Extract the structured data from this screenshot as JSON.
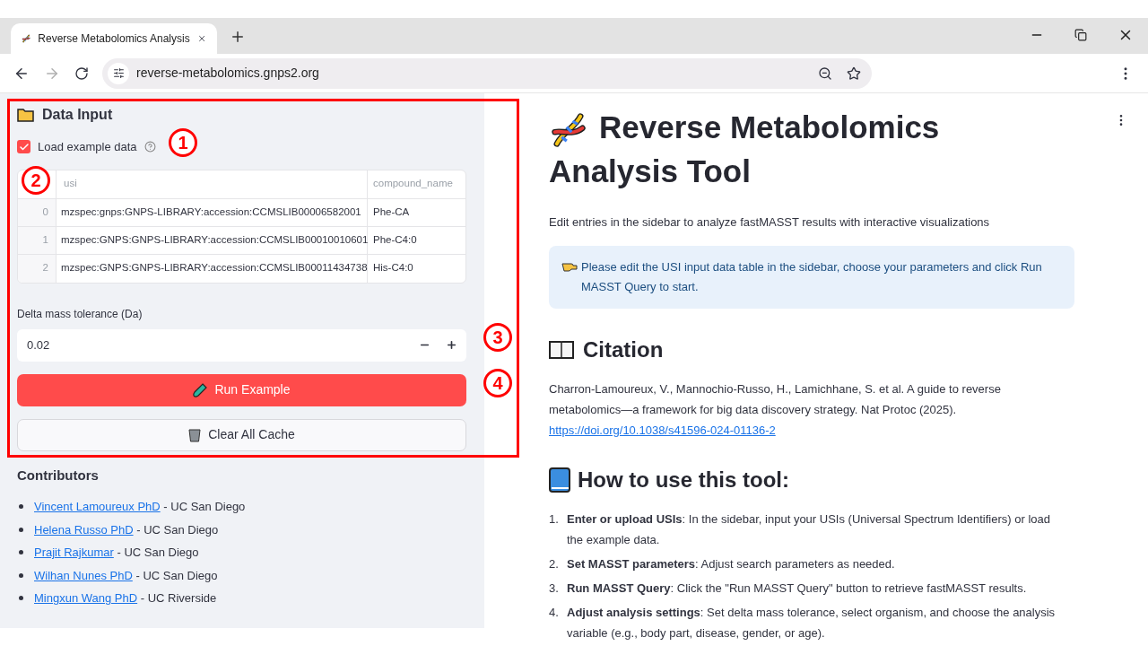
{
  "browser": {
    "tab_title": "Reverse Metabolomics Analysis",
    "url": "reverse-metabolomics.gnps2.org",
    "forward_disabled": true
  },
  "sidebar": {
    "section_title": "Data Input",
    "checkbox": {
      "label": "Load example data",
      "checked": true
    },
    "table": {
      "columns": [
        "usi",
        "compound_name"
      ],
      "rows": [
        {
          "index": "0",
          "usi": "mzspec:gnps:GNPS-LIBRARY:accession:CCMSLIB00006582001",
          "compound_name": "Phe-CA"
        },
        {
          "index": "1",
          "usi": "mzspec:GNPS:GNPS-LIBRARY:accession:CCMSLIB00010010601",
          "compound_name": "Phe-C4:0"
        },
        {
          "index": "2",
          "usi": "mzspec:GNPS:GNPS-LIBRARY:accession:CCMSLIB00011434738",
          "compound_name": "His-C4:0"
        }
      ]
    },
    "tolerance": {
      "label": "Delta mass tolerance (Da)",
      "value": "0.02"
    },
    "buttons": [
      {
        "label": "Run Example",
        "kind": "primary"
      },
      {
        "label": "Clear All Cache",
        "kind": "secondary"
      }
    ],
    "contributors_title": "Contributors",
    "contributors": [
      {
        "name": "Vincent Lamoureux PhD",
        "affiliation": "- UC San Diego"
      },
      {
        "name": "Helena Russo PhD",
        "affiliation": "- UC San Diego"
      },
      {
        "name": "Prajit Rajkumar",
        "affiliation": "- UC San Diego"
      },
      {
        "name": "Wilhan Nunes PhD",
        "affiliation": "- UC San Diego"
      },
      {
        "name": "Mingxun Wang PhD",
        "affiliation": "- UC Riverside"
      }
    ]
  },
  "main": {
    "title": "Reverse Metabolomics Analysis Tool",
    "subtitle": "Edit entries in the sidebar to analyze fastMASST results with interactive visualizations",
    "info": "Please edit the USI input data table in the sidebar, choose your parameters and click Run MASST Query to start.",
    "citation_title": "Citation",
    "citation_text": "Charron-Lamoureux, V., Mannochio-Russo, H., Lamichhane, S. et al. A guide to reverse metabolomics—a framework for big data discovery strategy. Nat Protoc (2025).",
    "citation_link": "https://doi.org/10.1038/s41596-024-01136-2",
    "howto_title": "How to use this tool:",
    "steps": [
      {
        "number": "1.",
        "text": "**Enter or upload USIs**: In the sidebar, input your USIs (Universal Spectrum Identifiers) or load the example data."
      },
      {
        "number": "2.",
        "text": "**Set MASST parameters**: Adjust search parameters as needed."
      },
      {
        "number": "3.",
        "text": "**Run MASST Query**: Click the \"Run MASST Query\" button to retrieve fastMASST results."
      },
      {
        "number": "4.",
        "text": "**Adjust analysis settings**: Set delta mass tolerance, select organism, and choose the analysis variable (e.g., body part, disease, gender, or age)."
      }
    ]
  },
  "annotations": [
    "1",
    "2",
    "3",
    "4"
  ]
}
